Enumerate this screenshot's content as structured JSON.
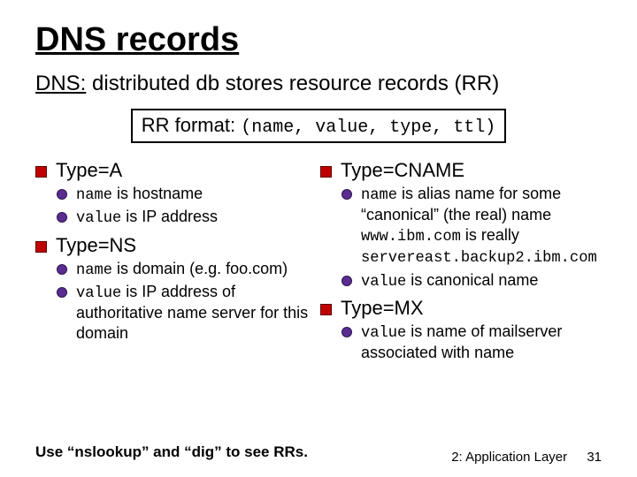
{
  "title": "DNS records",
  "subtitle_prefix": "DNS:",
  "subtitle_rest": " distributed db stores resource records (RR)",
  "rrbox_prefix": "RR format: ",
  "rrbox_tuple": "(name, value, type, ttl)",
  "left": {
    "typeA": {
      "heading": "Type=A",
      "b1_pre": "",
      "b1_code": "name",
      "b1_post": " is hostname",
      "b2_pre": "",
      "b2_code": "value",
      "b2_post": " is IP address"
    },
    "typeNS": {
      "heading": "Type=NS",
      "b1_pre": "",
      "b1_code": "name",
      "b1_post": " is domain (e.g. foo.com)",
      "b2_pre": "",
      "b2_code": "value",
      "b2_post": " is IP address of authoritative name server for this domain"
    }
  },
  "right": {
    "typeCNAME": {
      "heading": "Type=CNAME",
      "b1_pre": "",
      "b1_code": "name",
      "b1_post1": " is alias name for some “canonical” (the real) name",
      "b1_ex1": "www.ibm.com",
      "b1_mid": " is really ",
      "b1_ex2": "servereast.backup2.ibm.com",
      "b2_pre": "",
      "b2_code": "value",
      "b2_post": " is canonical name"
    },
    "typeMX": {
      "heading": "Type=MX",
      "b1_pre": "",
      "b1_code": "value",
      "b1_post": " is name of mailserver associated with name"
    }
  },
  "tip": "Use “nslookup” and “dig” to see RRs.",
  "footer_section": "2: Application Layer",
  "footer_page": "31"
}
